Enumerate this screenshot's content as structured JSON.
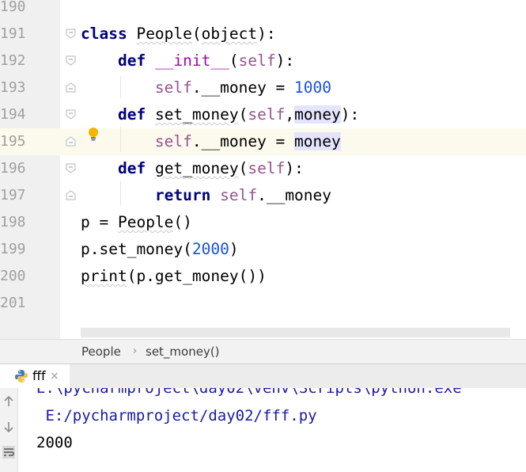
{
  "editor": {
    "line_numbers": [
      "190",
      "191",
      "192",
      "193",
      "194",
      "195",
      "196",
      "197",
      "198",
      "199",
      "200",
      "201"
    ],
    "lines": [
      {
        "tokens": [
          {
            "t": "class",
            "c": "kw"
          },
          {
            "t": " "
          },
          {
            "t": "People",
            "c": "squig"
          },
          {
            "t": "("
          },
          {
            "t": "object",
            "c": "squig"
          },
          {
            "t": "):"
          }
        ]
      },
      {
        "tokens": [
          {
            "t": "    "
          },
          {
            "t": "def",
            "c": "kw"
          },
          {
            "t": " "
          },
          {
            "t": "__init__",
            "c": "magic"
          },
          {
            "t": "("
          },
          {
            "t": "self",
            "c": "self"
          },
          {
            "t": "):"
          }
        ]
      },
      {
        "tokens": [
          {
            "t": "        "
          },
          {
            "t": "self",
            "c": "self"
          },
          {
            "t": ".__money = "
          },
          {
            "t": "1000",
            "c": "num"
          }
        ]
      },
      {
        "tokens": [
          {
            "t": "    "
          },
          {
            "t": "def",
            "c": "kw"
          },
          {
            "t": " "
          },
          {
            "t": "set_money",
            "c": "squig"
          },
          {
            "t": "("
          },
          {
            "t": "self",
            "c": "self"
          },
          {
            "t": ","
          },
          {
            "t": "money",
            "c": "param-hl"
          },
          {
            "t": "):"
          }
        ]
      },
      {
        "tokens": [
          {
            "t": "        "
          },
          {
            "t": "self",
            "c": "self"
          },
          {
            "t": ".__money = "
          },
          {
            "t": "money",
            "c": "param-hl"
          }
        ]
      },
      {
        "tokens": [
          {
            "t": "    "
          },
          {
            "t": "def",
            "c": "kw"
          },
          {
            "t": " "
          },
          {
            "t": "get_money",
            "c": "squig"
          },
          {
            "t": "("
          },
          {
            "t": "self",
            "c": "self"
          },
          {
            "t": "):"
          }
        ]
      },
      {
        "tokens": [
          {
            "t": "        "
          },
          {
            "t": "return",
            "c": "kw"
          },
          {
            "t": " "
          },
          {
            "t": "self",
            "c": "self"
          },
          {
            "t": ".__money"
          }
        ]
      },
      {
        "tokens": [
          {
            "t": "p = "
          },
          {
            "t": "People",
            "c": "squig"
          },
          {
            "t": "()"
          }
        ]
      },
      {
        "tokens": [
          {
            "t": "p.set_money("
          },
          {
            "t": "2000",
            "c": "num"
          },
          {
            "t": ")"
          }
        ]
      },
      {
        "tokens": [
          {
            "t": "print",
            "c": "squig"
          },
          {
            "t": "(p.get_money())"
          }
        ]
      }
    ]
  },
  "breadcrumb": {
    "items": [
      "People",
      "set_money()"
    ],
    "separator": "›"
  },
  "run_panel": {
    "tab_label": "fff",
    "close_symbol": "×",
    "output": {
      "cmd_line1": "E:\\pycharmproject\\day02\\venv\\Scripts\\python.exe",
      "cmd_line2": " E:/pycharmproject/day02/fff.py",
      "result": "2000"
    }
  },
  "icons": {
    "fold": "fold-marker-icon",
    "bulb": "intention-bulb-icon",
    "python": "python-icon",
    "up": "arrow-up-icon",
    "down": "arrow-down-icon",
    "wrap": "soft-wrap-icon"
  },
  "colors": {
    "keyword": "#000080",
    "self": "#94558d",
    "number": "#1750eb",
    "magic": "#b200b2",
    "current_line": "#fcfaed",
    "param_highlight": "#e4e4ff",
    "console_path": "#1a1aa6"
  }
}
